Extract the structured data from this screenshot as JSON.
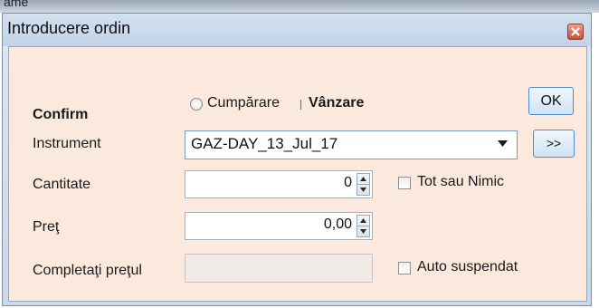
{
  "background": {
    "partial_text": "ame"
  },
  "window": {
    "title": "Introducere ordin",
    "close_icon": "close-icon"
  },
  "form": {
    "confirm_label": "Confirm",
    "buy_label": "Cumpărare",
    "sell_label": "Vânzare",
    "buy_selected": false,
    "ok_label": "OK",
    "instrument_label": "Instrument",
    "instrument_value": "GAZ-DAY_13_Jul_17",
    "more_label": ">>",
    "quantity_label": "Cantitate",
    "quantity_value": "0",
    "all_or_none_label": "Tot sau Nimic",
    "all_or_none_checked": false,
    "price_label": "Preţ",
    "price_value": "0,00",
    "fill_price_label": "Completaţi preţul",
    "fill_price_value": "",
    "auto_suspended_label": "Auto suspendat",
    "auto_suspended_checked": false
  }
}
